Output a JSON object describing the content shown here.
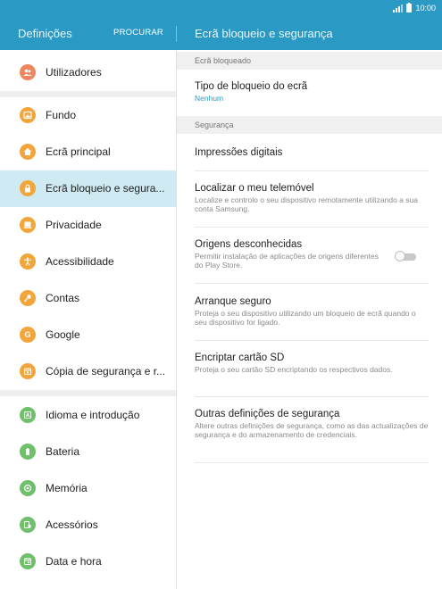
{
  "status": {
    "time": "10:00"
  },
  "appbar": {
    "title": "Definições",
    "search_label": "PROCURAR",
    "detail_title": "Ecrã bloqueio e segurança"
  },
  "sidebar": {
    "items": [
      {
        "label": "Utilizadores",
        "icon": "users-icon",
        "color": "#f0865e"
      },
      {
        "label": "Fundo",
        "icon": "wallpaper-icon",
        "color": "#f2a53a"
      },
      {
        "label": "Ecrã principal",
        "icon": "home-icon",
        "color": "#f2a53a"
      },
      {
        "label": "Ecrã bloqueio e segura...",
        "icon": "lock-icon",
        "color": "#f2a53a",
        "selected": true
      },
      {
        "label": "Privacidade",
        "icon": "privacy-icon",
        "color": "#f2a53a"
      },
      {
        "label": "Acessibilidade",
        "icon": "accessibility-icon",
        "color": "#f2a53a"
      },
      {
        "label": "Contas",
        "icon": "key-icon",
        "color": "#f2a53a"
      },
      {
        "label": "Google",
        "icon": "google-icon",
        "color": "#f2a53a"
      },
      {
        "label": "Cópia de segurança e r...",
        "icon": "backup-icon",
        "color": "#f2a53a"
      },
      {
        "label": "Idioma e introdução",
        "icon": "language-icon",
        "color": "#6fbf6b"
      },
      {
        "label": "Bateria",
        "icon": "battery-icon",
        "color": "#6fbf6b"
      },
      {
        "label": "Memória",
        "icon": "storage-icon",
        "color": "#6fbf6b"
      },
      {
        "label": "Acessórios",
        "icon": "accessories-icon",
        "color": "#6fbf6b"
      },
      {
        "label": "Data e hora",
        "icon": "calendar-icon",
        "color": "#6fbf6b"
      }
    ]
  },
  "detail": {
    "sections": [
      {
        "header": "Ecrã bloqueado"
      },
      {
        "header": "Segurança"
      }
    ],
    "settings": [
      {
        "title": "Tipo de bloqueio do ecrã",
        "sub": "Nenhum"
      },
      {
        "title": "Impressões digitais",
        "sub": ""
      },
      {
        "title": "Localizar o meu telemóvel",
        "sub": "Localize e controlo o seu dispositivo remotamente utilizando a sua conta Samsung."
      },
      {
        "title": "Origens desconhecidas",
        "sub": "Permitir instalação de aplicações de origens diferentes do Play Store.",
        "toggle": false
      },
      {
        "title": "Arranque seguro",
        "sub": "Proteja o seu dispositivo utilizando um bloqueio de ecrã quando o seu dispositivo for ligado."
      },
      {
        "title": "Encriptar cartão SD",
        "sub": "Proteja o seu cartão SD encriptando os respectivos dados."
      },
      {
        "title": "Outras definições de segurança",
        "sub": "Altere outras definições de segurança, como as das actualizações de segurança e do armazenamento de credenciais."
      }
    ]
  },
  "colors": {
    "accent": "#2a9ac4",
    "selected_row": "#cfeaf3",
    "orange_icon": "#f2a53a",
    "green_icon": "#6fbf6b"
  }
}
